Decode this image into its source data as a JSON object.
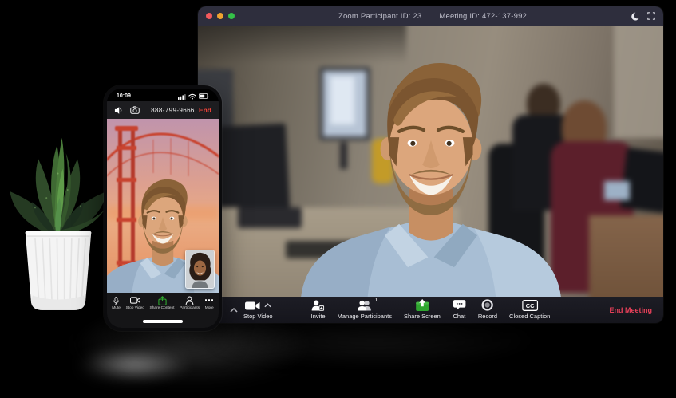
{
  "desktop_window": {
    "titlebar": {
      "participant_id": "Zoom Participant ID: 23",
      "meeting_id": "Meeting ID: 472-137-992"
    },
    "toolbar": {
      "stop_video": "Stop Video",
      "invite": "Invite",
      "manage_participants": "Manage Participants",
      "participants_badge": "1",
      "share_screen": "Share Screen",
      "chat": "Chat",
      "record": "Record",
      "closed_caption": "Closed Caption",
      "cc_text": "CC",
      "end_meeting": "End Meeting"
    }
  },
  "phone": {
    "statusbar": {
      "time": "10:09"
    },
    "callbar": {
      "phone_number": "888-799-9666",
      "end_label": "End"
    },
    "toolbar": {
      "mute": "Mute",
      "stop_video": "Stop Video",
      "share_content": "Share Content",
      "participants": "Participants",
      "more": "More"
    }
  },
  "colors": {
    "titlebar_bg": "#2e2e3d",
    "traffic_red": "#f3595c",
    "traffic_yellow": "#efa32f",
    "traffic_green": "#34c148",
    "share_green": "#2fa52f",
    "end_meeting_red": "#e84059",
    "phone_end_red": "#fd453a"
  }
}
